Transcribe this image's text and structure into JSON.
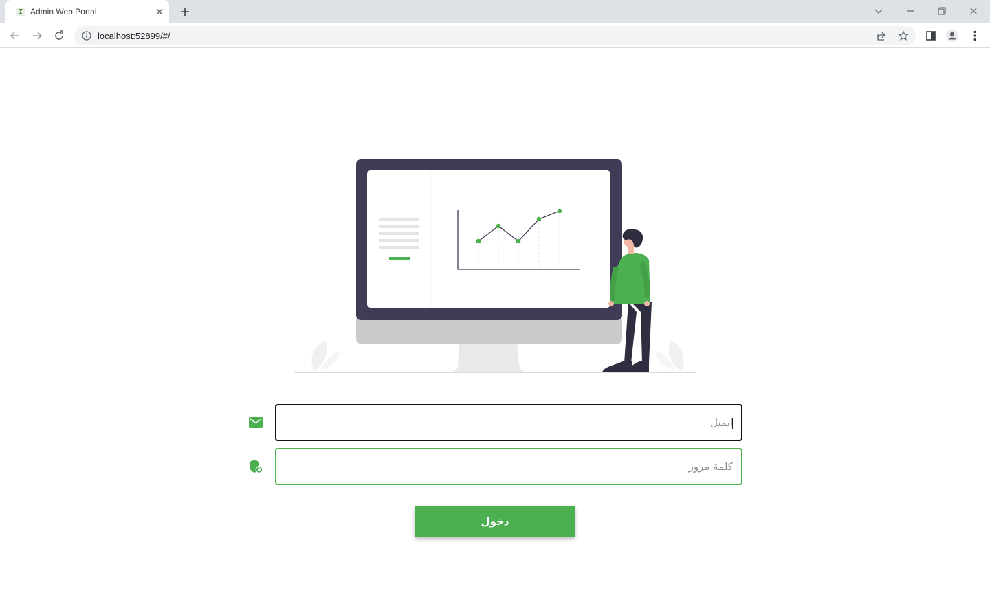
{
  "browser": {
    "tab_title": "Admin Web Portal",
    "url": "localhost:52899/#/"
  },
  "login": {
    "email_placeholder": "ايميل",
    "password_placeholder": "كلمة مرور",
    "submit_label": "دخول"
  },
  "icons": {
    "email": "envelope-icon",
    "password": "shield-lock-icon"
  },
  "colors": {
    "accent": "#4caf50",
    "monitor_frame": "#3f3d56",
    "tabstrip": "#dee1e6"
  }
}
